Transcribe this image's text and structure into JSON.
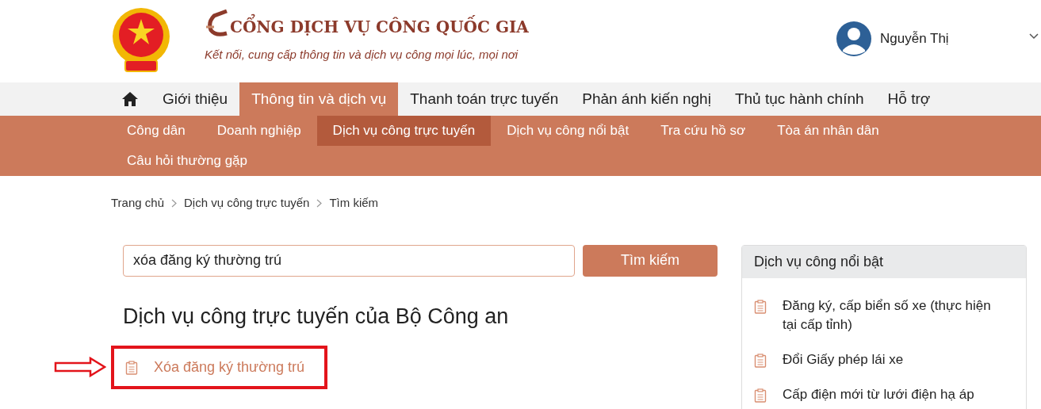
{
  "header": {
    "title": "CỔNG DỊCH VỤ CÔNG QUỐC GIA",
    "tagline": "Kết nối, cung cấp thông tin và dịch vụ công mọi lúc, mọi nơi",
    "user": "Nguyễn Thị"
  },
  "main_nav": [
    {
      "label": "Giới thiệu",
      "selected": false
    },
    {
      "label": "Thông tin và dịch vụ",
      "selected": true
    },
    {
      "label": "Thanh toán trực tuyến",
      "selected": false
    },
    {
      "label": "Phản ánh kiến nghị",
      "selected": false
    },
    {
      "label": "Thủ tục hành chính",
      "selected": false
    },
    {
      "label": "Hỗ trợ",
      "selected": false
    }
  ],
  "sub_nav": [
    {
      "label": "Công dân",
      "selected": false
    },
    {
      "label": "Doanh nghiệp",
      "selected": false
    },
    {
      "label": "Dịch vụ công trực tuyến",
      "selected": true
    },
    {
      "label": "Dịch vụ công nổi bật",
      "selected": false
    },
    {
      "label": "Tra cứu hồ sơ",
      "selected": false
    },
    {
      "label": "Tòa án nhân dân",
      "selected": false
    },
    {
      "label": "Câu hỏi thường gặp",
      "selected": false
    }
  ],
  "breadcrumb": [
    "Trang chủ",
    "Dịch vụ công trực tuyến",
    "Tìm kiếm"
  ],
  "search": {
    "value": "xóa đăng ký thường trú",
    "button": "Tìm kiếm"
  },
  "results": {
    "heading": "Dịch vụ công trực tuyến của Bộ Công an",
    "items": [
      "Xóa đăng ký thường trú"
    ]
  },
  "featured": {
    "title": "Dịch vụ công nổi bật",
    "items": [
      "Đăng ký, cấp biển số xe (thực hiện tại cấp tỉnh)",
      "Đổi Giấy phép lái xe",
      "Cấp điện mới từ lưới điện hạ áp"
    ]
  }
}
